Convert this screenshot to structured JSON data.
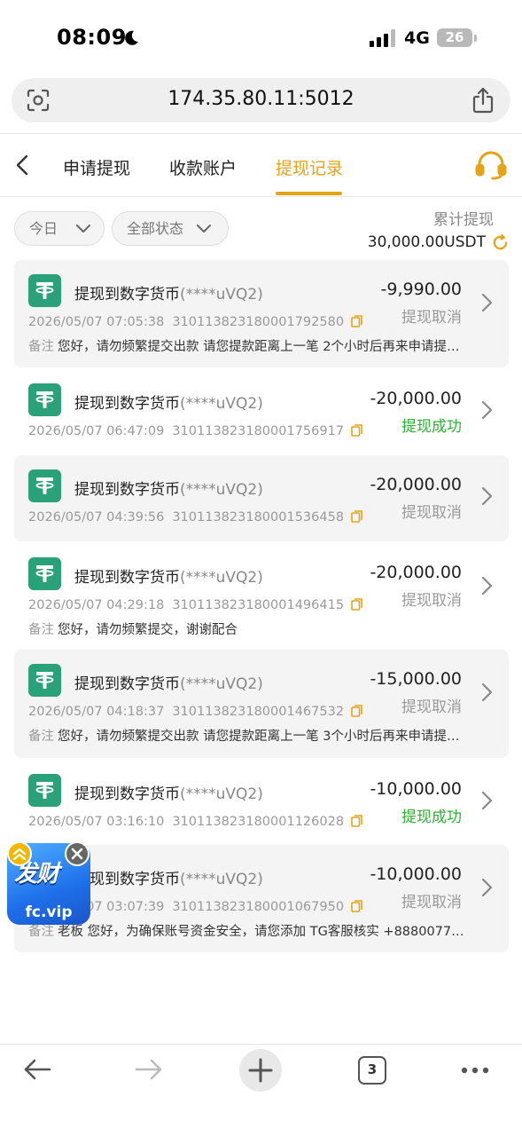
{
  "status_bar": {
    "time": "08:09",
    "network": "4G",
    "battery": "26"
  },
  "browser": {
    "url": "174.35.80.11:5012",
    "tab_count": "3"
  },
  "tabs": [
    {
      "label": "申请提现",
      "active": false
    },
    {
      "label": "收款账户",
      "active": false
    },
    {
      "label": "提现记录",
      "active": true
    }
  ],
  "filters": {
    "date": "今日",
    "status": "全部状态"
  },
  "summary": {
    "label": "累计提现",
    "amount": "30,000.00USDT"
  },
  "note_label": "备注",
  "records": [
    {
      "title": "提现到数字货币",
      "account": "(****uVQ2)",
      "amount": "-9,990.00",
      "status": "提现取消",
      "status_type": "cancel",
      "datetime": "2026/05/07 07:05:38",
      "order_no": "310113823180001792580",
      "note": "您好，请勿频繁提交出款 请您提款距离上一笔 2个小时后再来申请提款..."
    },
    {
      "title": "提现到数字货币",
      "account": "(****uVQ2)",
      "amount": "-20,000.00",
      "status": "提现成功",
      "status_type": "success",
      "datetime": "2026/05/07 06:47:09",
      "order_no": "310113823180001756917",
      "note": ""
    },
    {
      "title": "提现到数字货币",
      "account": "(****uVQ2)",
      "amount": "-20,000.00",
      "status": "提现取消",
      "status_type": "cancel",
      "datetime": "2026/05/07 04:39:56",
      "order_no": "310113823180001536458",
      "note": ""
    },
    {
      "title": "提现到数字货币",
      "account": "(****uVQ2)",
      "amount": "-20,000.00",
      "status": "提现取消",
      "status_type": "cancel",
      "datetime": "2026/05/07 04:29:18",
      "order_no": "310113823180001496415",
      "note": "您好，请勿频繁提交，谢谢配合"
    },
    {
      "title": "提现到数字货币",
      "account": "(****uVQ2)",
      "amount": "-15,000.00",
      "status": "提现取消",
      "status_type": "cancel",
      "datetime": "2026/05/07 04:18:37",
      "order_no": "310113823180001467532",
      "note": "您好，请勿频繁提交出款 请您提款距离上一笔 3个小时后再来申请提款..."
    },
    {
      "title": "提现到数字货币",
      "account": "(****uVQ2)",
      "amount": "-10,000.00",
      "status": "提现成功",
      "status_type": "success",
      "datetime": "2026/05/07 03:16:10",
      "order_no": "310113823180001126028",
      "note": ""
    },
    {
      "title": "提现到数字货币",
      "account": "(****uVQ2)",
      "amount": "-10,000.00",
      "status": "提现取消",
      "status_type": "cancel",
      "datetime": "2026/05/07 03:07:39",
      "order_no": "310113823180001067950",
      "note": "老板 您好，为确保账号资金安全，请您添加 TG客服核实 +888007788..."
    }
  ],
  "float_ad": {
    "brand": "发财",
    "url": "fc.vip"
  },
  "colors": {
    "accent": "#e5a317",
    "success": "#2ab52f",
    "cancel": "#9a9a9a",
    "coin": "#2aa179"
  },
  "icons": [
    "moon-icon",
    "signal-icon",
    "scan-icon",
    "share-icon",
    "back-icon",
    "support-headset-icon",
    "chevron-down-icon",
    "refresh-icon",
    "tether-coin-icon",
    "copy-icon",
    "chevron-right-icon",
    "close-icon",
    "back-arrow-icon",
    "forward-arrow-icon",
    "plus-icon",
    "more-icon"
  ]
}
